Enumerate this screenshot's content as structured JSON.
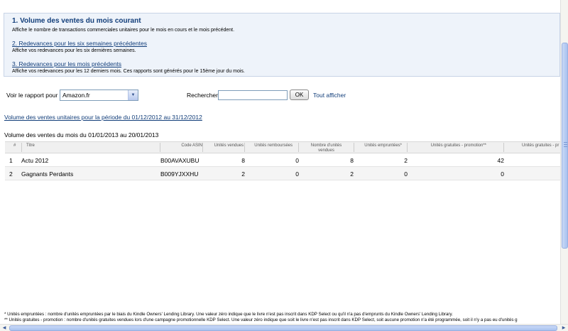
{
  "info": {
    "title": "1. Volume des ventes du mois courant",
    "title_desc": "Affiche le nombre de transactions commerciales unitaires pour le mois en cours et le mois précédent.",
    "link1": "2. Redevances pour les six semaines précédentes",
    "link1_desc": "Affiche vos redevances pour les six dernières semaines.",
    "link2": "3. Redevances pour les mois précédents",
    "link2_desc": "Affiche vos redevances pour les 12 derniers mois. Ces rapports sont générés pour le 15ème jour du mois."
  },
  "filter": {
    "report_label": "Voir le rapport pour :",
    "report_value": "Amazon.fr",
    "search_label": "Rechercher",
    "search_value": "",
    "ok_label": "OK",
    "show_all_label": "Tout afficher"
  },
  "period_link": "Volume des ventes unitaires pour la période du 01/12/2012 au 31/12/2012",
  "period_label": "Volume des ventes du mois du 01/01/2013 au 20/01/2013",
  "table": {
    "headers": {
      "index": "#",
      "title": "Titre",
      "asin": "Code ASIN",
      "sold": "Unités vendues",
      "refunded": "Unités remboursées",
      "net_1": "Nombre d'unités",
      "net_2": "vendues",
      "borrowed": "Unités empruntées*",
      "free": "Unités gratuites - promotion**",
      "free_cut": "Unités gratuites - pr"
    },
    "rows": [
      {
        "index": "1",
        "title": "Actu 2012",
        "asin": "B00AVAXUBU",
        "sold": "8",
        "refunded": "0",
        "net": "8",
        "borrowed": "2",
        "free": "42"
      },
      {
        "index": "2",
        "title": "Gagnants Perdants",
        "asin": "B009YJXXHU",
        "sold": "2",
        "refunded": "0",
        "net": "2",
        "borrowed": "0",
        "free": "0"
      }
    ]
  },
  "footnotes": {
    "borrowed": "* Unités empruntées : nombre d'unités empruntées par le biais du Kindle Owners' Lending Library. Une valeur zéro indique que le livre n'est pas inscrit dans KDP Select ou qu'il n'a pas d'emprunts du Kindle Owners' Lending Library.",
    "free": "** Unités gratuites - promotion : nombre d'unités gratuites vendues lors d'une campagne promotionnelle KDP Select. Une valeur zéro indique que soit le livre n'est pas inscrit dans KDP Select, soit aucune promotion n'a été programmée, soit il n'y a pas eu d'unités g"
  },
  "scroll_arrows": {
    "left": "◀",
    "right": "▶",
    "dropdown": "▼"
  }
}
